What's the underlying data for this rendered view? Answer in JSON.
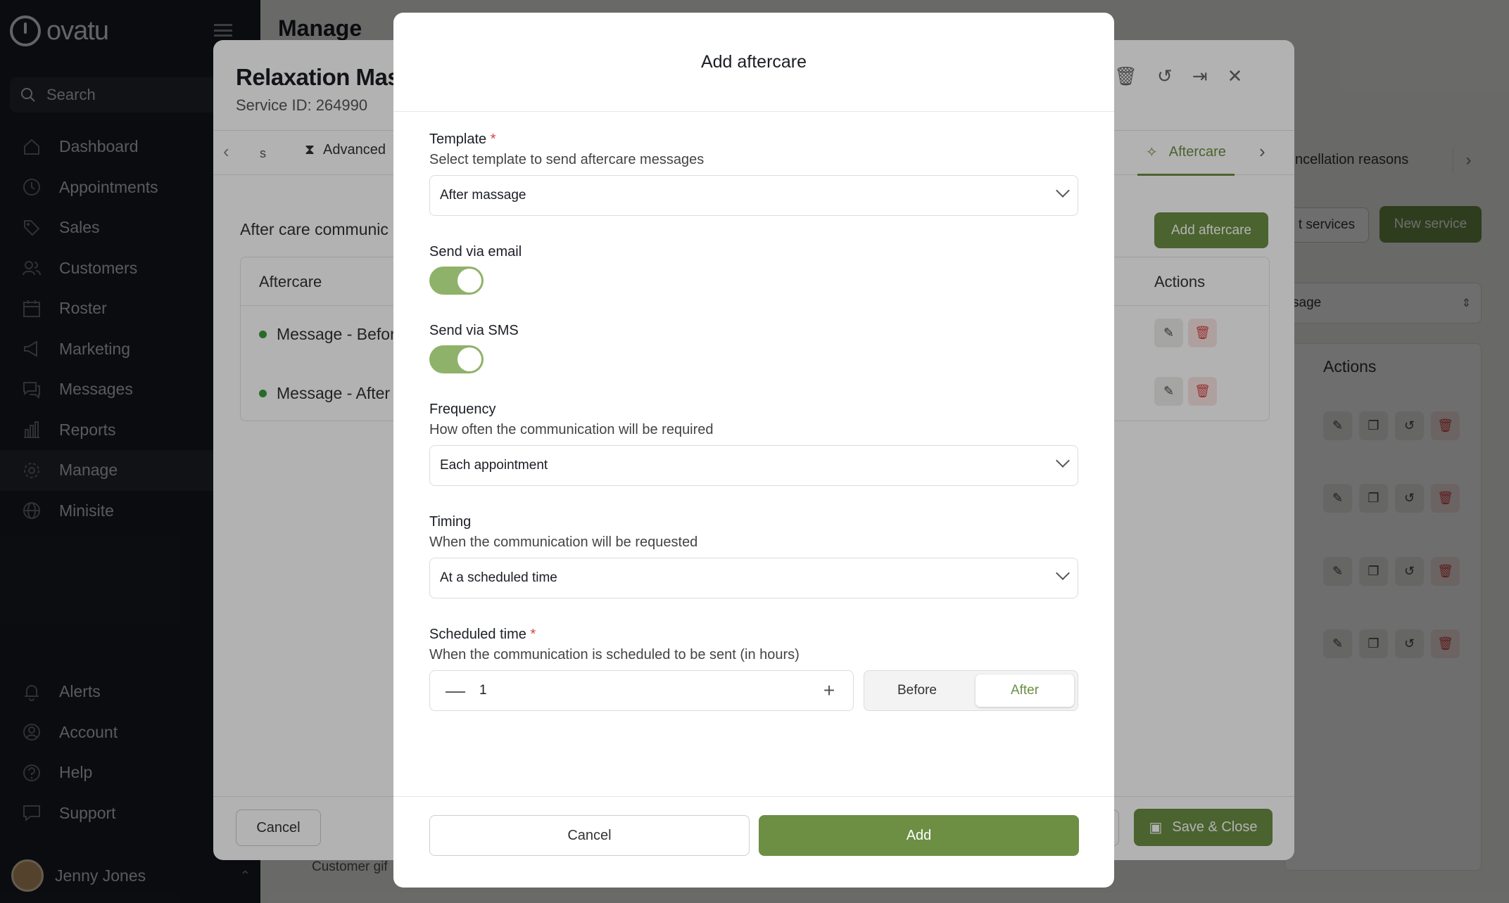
{
  "app": {
    "logo": "ovatu",
    "bg_title": "Manage"
  },
  "sidebar": {
    "search_label": "Search",
    "items": [
      {
        "label": "Dashboard",
        "icon": "home-icon"
      },
      {
        "label": "Appointments",
        "icon": "clock-icon"
      },
      {
        "label": "Sales",
        "icon": "tag-icon"
      },
      {
        "label": "Customers",
        "icon": "users-icon"
      },
      {
        "label": "Roster",
        "icon": "calendar-icon"
      },
      {
        "label": "Marketing",
        "icon": "megaphone-icon"
      },
      {
        "label": "Messages",
        "icon": "chat-icon"
      },
      {
        "label": "Reports",
        "icon": "chart-icon"
      },
      {
        "label": "Manage",
        "icon": "gear-icon"
      },
      {
        "label": "Minisite",
        "icon": "globe-icon"
      }
    ],
    "bottom_items": [
      {
        "label": "Alerts",
        "icon": "bell-icon"
      },
      {
        "label": "Account",
        "icon": "account-icon"
      },
      {
        "label": "Help",
        "icon": "help-icon"
      },
      {
        "label": "Support",
        "icon": "support-icon"
      }
    ],
    "user_name": "Jenny Jones"
  },
  "background": {
    "tab_text": "ncellation reasons",
    "btn_services": "t services",
    "btn_new_service": "New service",
    "select_value": "sage",
    "actions_header": "Actions",
    "customer_text": "Customer gif"
  },
  "service_modal": {
    "title": "Relaxation Mas",
    "service_id": "Service ID: 264990",
    "tab_s": "s",
    "tab_advanced": "Advanced",
    "tab_aftercare": "Aftercare",
    "section_title": "After care communic",
    "add_aftercare": "Add aftercare",
    "col_aftercare": "Aftercare",
    "col_actions": "Actions",
    "rows": [
      "Message - Befor",
      "Message - After"
    ],
    "cancel": "Cancel",
    "save_close": "Save & Close"
  },
  "dialog": {
    "title": "Add aftercare",
    "template": {
      "label": "Template",
      "required": "*",
      "hint": "Select template to send aftercare messages",
      "value": "After massage"
    },
    "email": {
      "label": "Send via email",
      "on": true
    },
    "sms": {
      "label": "Send via SMS",
      "on": true
    },
    "frequency": {
      "label": "Frequency",
      "hint": "How often the communication will be required",
      "value": "Each appointment"
    },
    "timing": {
      "label": "Timing",
      "hint": "When the communication will be requested",
      "value": "At a scheduled time"
    },
    "scheduled": {
      "label": "Scheduled time",
      "required": "*",
      "hint": "When the communication is scheduled to be sent (in hours)",
      "value": "1",
      "minus": "—",
      "plus": "+"
    },
    "before_label": "Before",
    "after_label": "After",
    "cancel": "Cancel",
    "add": "Add"
  },
  "colors": {
    "accent": "#6c8f44",
    "danger": "#d64545",
    "sidebar_bg": "#1b1e25"
  }
}
